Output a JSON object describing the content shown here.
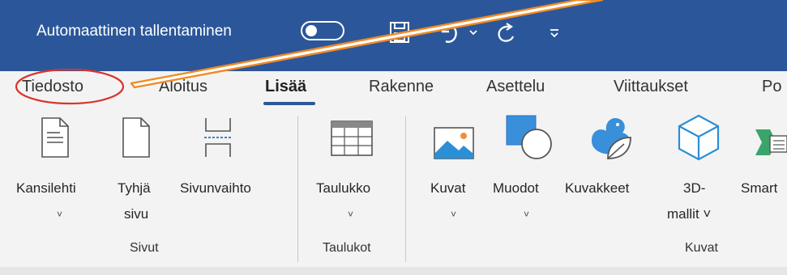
{
  "titlebar": {
    "autosave_label": "Automaattinen tallentaminen"
  },
  "tabs": [
    "Tiedosto",
    "Aloitus",
    "Lisää",
    "Rakenne",
    "Asettelu",
    "Viittaukset",
    "Po"
  ],
  "ribbon": {
    "buttons": [
      {
        "label1": "Kansilehti",
        "label2": ""
      },
      {
        "label1": "Tyhjä",
        "label2": "sivu"
      },
      {
        "label1": "Sivunvaihto",
        "label2": ""
      },
      {
        "label1": "Taulukko",
        "label2": ""
      },
      {
        "label1": "Kuvat",
        "label2": ""
      },
      {
        "label1": "Muodot",
        "label2": ""
      },
      {
        "label1": "Kuvakkeet",
        "label2": ""
      },
      {
        "label1": "3D-",
        "label2": "mallit ˅"
      },
      {
        "label1": "Smart",
        "label2": ""
      }
    ],
    "groups": [
      "Sivut",
      "Taulukot",
      "Kuvat"
    ]
  },
  "colors": {
    "title_bg": "#2b579a",
    "annotation": "#d9342b",
    "arrow": "#f08a24"
  }
}
